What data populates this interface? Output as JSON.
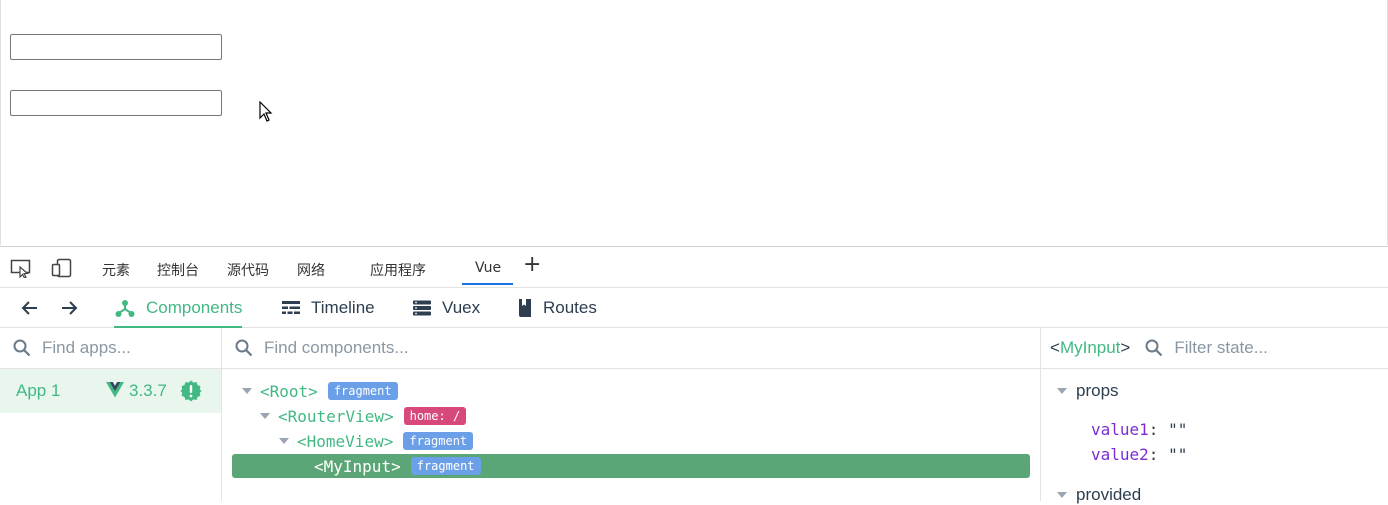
{
  "devtools_tabs": {
    "elements": "元素",
    "console": "控制台",
    "sources": "源代码",
    "network": "网络",
    "application": "应用程序",
    "vue": "Vue",
    "add": "+"
  },
  "vue_toolbar": {
    "components": "Components",
    "timeline": "Timeline",
    "vuex": "Vuex",
    "routes": "Routes"
  },
  "apps": {
    "search_placeholder": "Find apps...",
    "items": [
      {
        "name": "App 1",
        "version": "3.3.7"
      }
    ]
  },
  "components": {
    "search_placeholder": "Find components...",
    "tree": [
      {
        "bracket_open": "<",
        "name": "Root",
        "bracket_close": ">",
        "tag": "fragment"
      },
      {
        "bracket_open": "<",
        "name": "RouterView",
        "bracket_close": ">",
        "tag": "home: /"
      },
      {
        "bracket_open": "<",
        "name": "HomeView",
        "bracket_close": ">",
        "tag": "fragment"
      },
      {
        "bracket_open": "<",
        "name": "MyInput",
        "bracket_close": ">",
        "tag": "fragment"
      }
    ]
  },
  "inspector": {
    "component_open": "<",
    "component_name": "MyInput",
    "component_close": ">",
    "filter_placeholder": "Filter state...",
    "sections": {
      "props": "props",
      "provided": "provided"
    },
    "props": [
      {
        "key": "value1",
        "colon": ":",
        "value": "\"\""
      },
      {
        "key": "value2",
        "colon": ":",
        "value": "\"\""
      }
    ]
  },
  "colors": {
    "vue_green": "#42b883",
    "selected_row": "#5aa677",
    "fragment_tag": "#6b9fe8",
    "route_tag": "#d7487d",
    "devtools_accent": "#1a73e8"
  }
}
